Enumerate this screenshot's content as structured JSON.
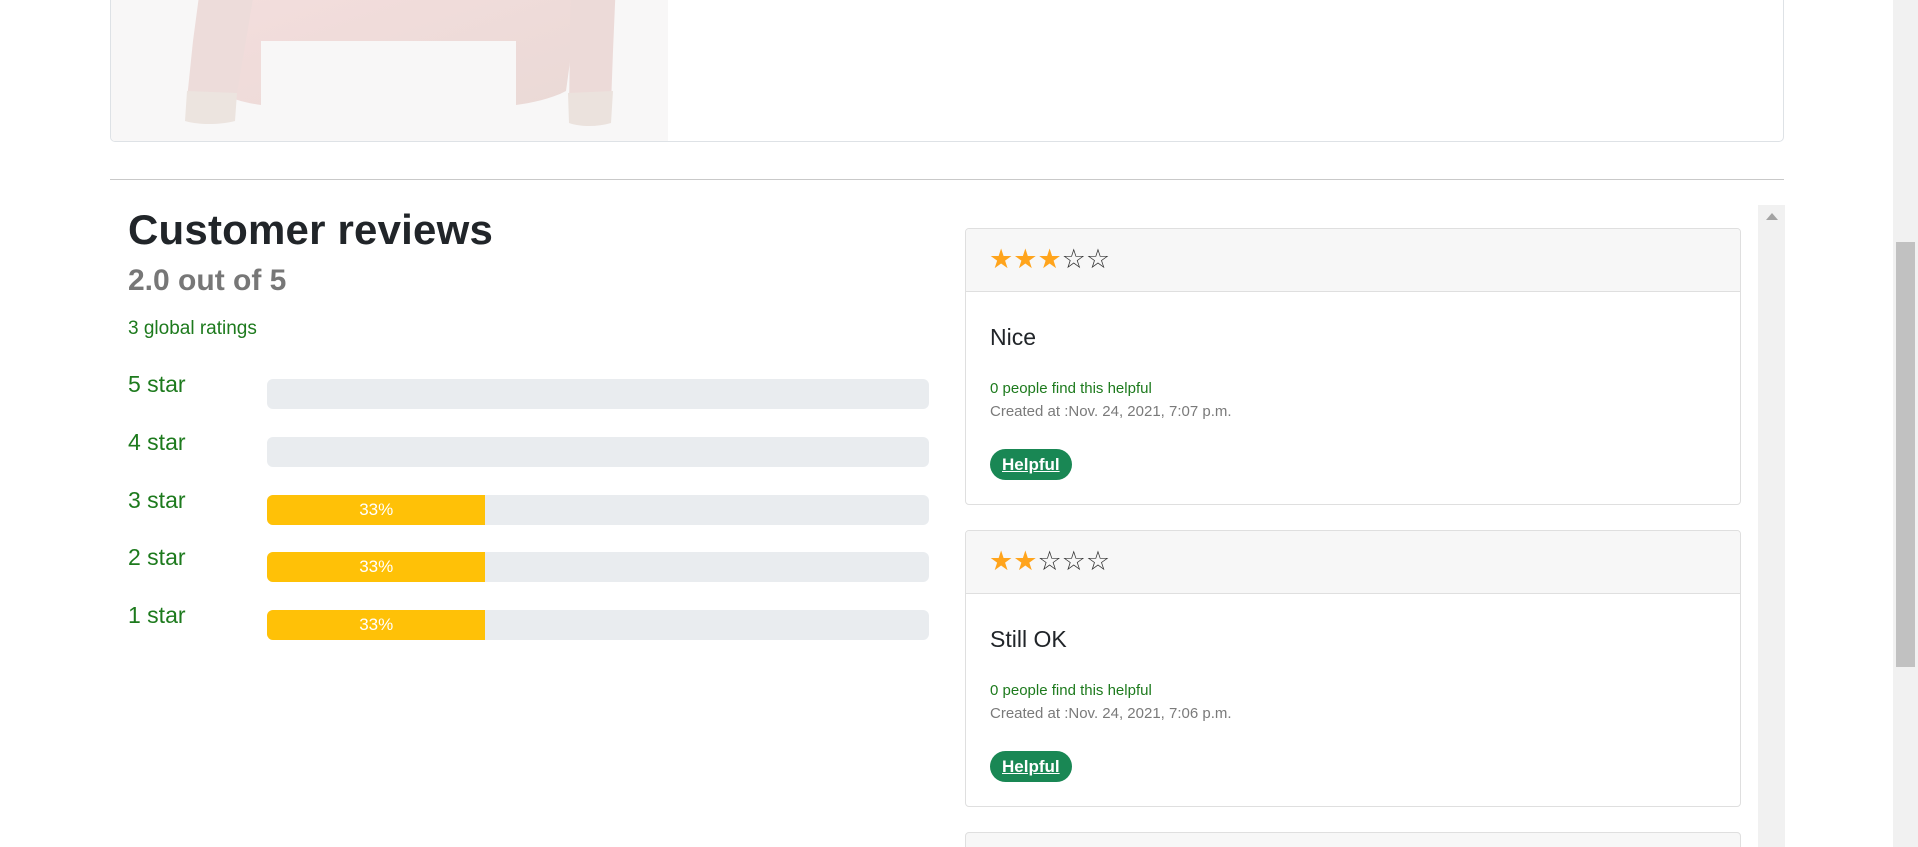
{
  "reviews_section": {
    "title": "Customer reviews",
    "average": "2.0 out of 5",
    "global_ratings": "3 global ratings",
    "distribution": [
      {
        "label": "5 star",
        "percent": 0,
        "text": ""
      },
      {
        "label": "4 star",
        "percent": 0,
        "text": ""
      },
      {
        "label": "3 star",
        "percent": 33,
        "text": "33%"
      },
      {
        "label": "2 star",
        "percent": 33,
        "text": "33%"
      },
      {
        "label": "1 star",
        "percent": 33,
        "text": "33%"
      }
    ]
  },
  "reviews": [
    {
      "rating": 3,
      "title": "Nice",
      "helpful_count": "0 people find this helpful",
      "created": "Created at :Nov. 24, 2021, 7:07 p.m.",
      "helpful_label": "Helpful"
    },
    {
      "rating": 2,
      "title": "Still OK",
      "helpful_count": "0 people find this helpful",
      "created": "Created at :Nov. 24, 2021, 7:06 p.m.",
      "helpful_label": "Helpful"
    }
  ],
  "colors": {
    "rating_link": "#1d7a1d",
    "bar_fill": "#ffc107",
    "star_on": "#ffa41c",
    "helpful_button": "#198754"
  },
  "icons": {
    "star_filled": "star-filled-icon",
    "star_empty": "star-empty-icon",
    "scroll_up": "scroll-up-arrow-icon"
  }
}
